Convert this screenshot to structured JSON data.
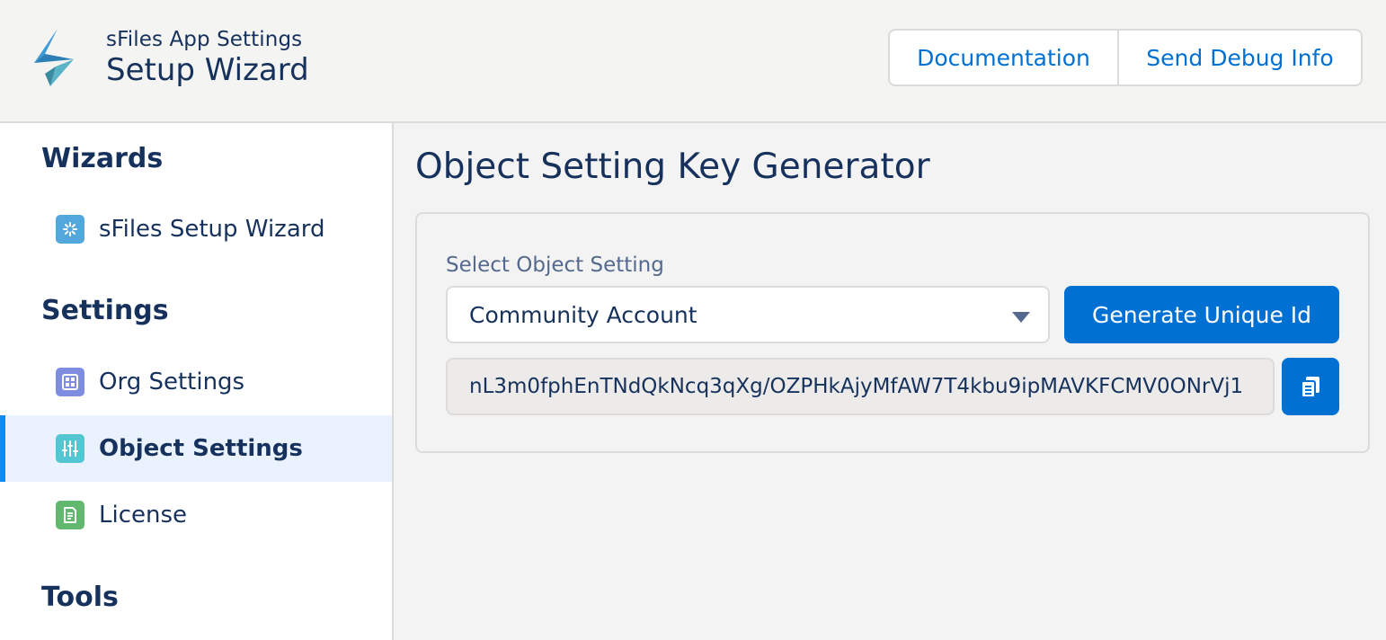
{
  "header": {
    "subtitle": "sFiles App Settings",
    "title": "Setup Wizard",
    "buttons": {
      "documentation": "Documentation",
      "debug": "Send Debug Info"
    }
  },
  "sidebar": {
    "sections": [
      {
        "heading": "Wizards",
        "items": [
          {
            "label": "sFiles Setup Wizard",
            "icon": "setup-wizard-icon",
            "color": "#54a7dd"
          }
        ]
      },
      {
        "heading": "Settings",
        "items": [
          {
            "label": "Org Settings",
            "icon": "org-settings-icon",
            "color": "#7f8de1"
          },
          {
            "label": "Object Settings",
            "icon": "object-settings-icon",
            "color": "#54c6d1",
            "active": true
          },
          {
            "label": "License",
            "icon": "license-icon",
            "color": "#62b86e"
          }
        ]
      },
      {
        "heading": "Tools",
        "items": []
      }
    ]
  },
  "main": {
    "title": "Object Setting Key Generator",
    "select_label": "Select Object Setting",
    "select_value": "Community Account",
    "generate_button": "Generate Unique Id",
    "generated_key": "nL3m0fphEnTNdQkNcq3qXg/OZPHkAjyMfAW7T4kbu9ipMAVKFCMV0ONrVj1",
    "copy_icon": "copy-icon"
  },
  "colors": {
    "brand": "#0070d2",
    "active_bg": "#eaf3fd",
    "active_indicator": "#1589ee",
    "text": "#16325c"
  }
}
